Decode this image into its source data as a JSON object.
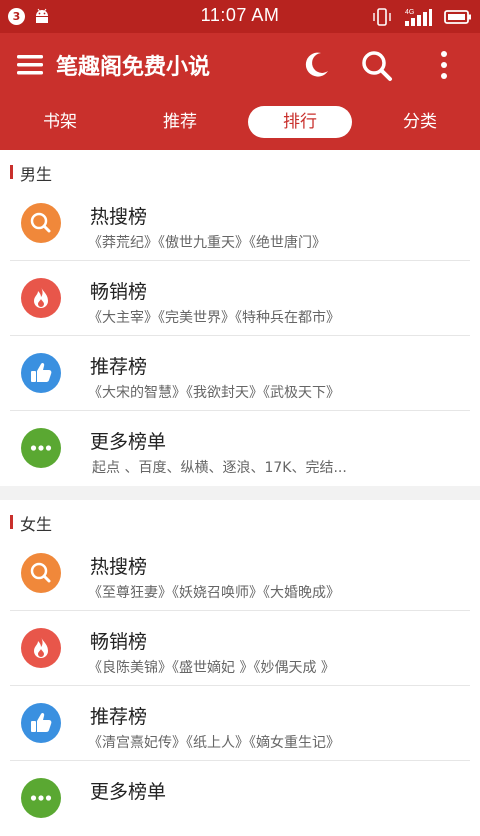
{
  "status": {
    "notification_count": "3",
    "time": "11:07 AM",
    "network_label": "4G"
  },
  "appbar": {
    "title": "笔趣阁免费小说",
    "icons": [
      "menu-icon",
      "moon-icon",
      "search-icon",
      "more-vert-icon"
    ]
  },
  "tabs": [
    {
      "label": "书架",
      "active": false
    },
    {
      "label": "推荐",
      "active": false
    },
    {
      "label": "排行",
      "active": true
    },
    {
      "label": "分类",
      "active": false
    }
  ],
  "sections": [
    {
      "title": "男生",
      "rows": [
        {
          "name": "热搜榜",
          "books": "《莽荒纪》《傲世九重天》《绝世唐门》",
          "icon": "search-icon",
          "color": "#f0883a"
        },
        {
          "name": "畅销榜",
          "books": "《大主宰》《完美世界》《特种兵在都市》",
          "icon": "fire-icon",
          "color": "#e8564a"
        },
        {
          "name": "推荐榜",
          "books": "《大宋的智慧》《我欲封天》《武极天下》",
          "icon": "thumbs-up-icon",
          "color": "#3a90e0"
        },
        {
          "name": "更多榜单",
          "books": "起点 、百度、纵横、逐浪、17K、完结...",
          "icon": "more-dots-icon",
          "color": "#5aa832"
        }
      ]
    },
    {
      "title": "女生",
      "rows": [
        {
          "name": "热搜榜",
          "books": "《至尊狂妻》《妖娆召唤师》《大婚晚成》",
          "icon": "search-icon",
          "color": "#f0883a"
        },
        {
          "name": "畅销榜",
          "books": "《良陈美锦》《盛世嫡妃 》《妙偶天成 》",
          "icon": "fire-icon",
          "color": "#e8564a"
        },
        {
          "name": "推荐榜",
          "books": "《清宫熹妃传》《纸上人》《嫡女重生记》",
          "icon": "thumbs-up-icon",
          "color": "#3a90e0"
        },
        {
          "name": "更多榜单",
          "books": "",
          "icon": "more-dots-icon",
          "color": "#5aa832"
        }
      ]
    }
  ]
}
